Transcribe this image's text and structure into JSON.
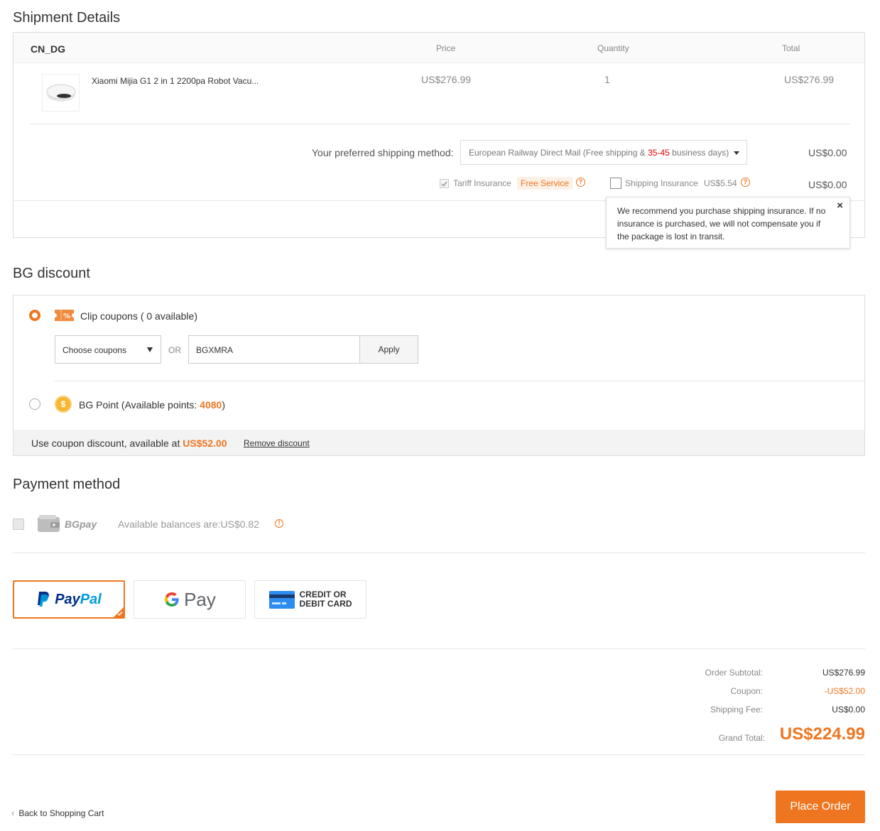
{
  "shipment": {
    "heading": "Shipment Details",
    "warehouse": "CN_DG",
    "columns": {
      "price": "Price",
      "quantity": "Quantity",
      "total": "Total"
    },
    "item": {
      "name": "Xiaomi Mijia G1 2 in 1 2200pa Robot Vacu...",
      "price": "US$276.99",
      "quantity": "1",
      "total": "US$276.99"
    },
    "shipping_method_label": "Your preferred shipping method:",
    "shipping_method_value_a": "European Railway Direct Mail (Free shipping & ",
    "shipping_method_value_days": "35-45",
    "shipping_method_value_b": " business days)",
    "shipping_cost": "US$0.00",
    "tariff_label": "Tariff Insurance",
    "tariff_badge": "Free Service",
    "shipping_insurance_label": "Shipping Insurance",
    "shipping_insurance_price": "US$5.54",
    "insurance_cost": "US$0.00",
    "tooltip_text": "We recommend you purchase shipping insurance. If no insurance is purchased, we will not compensate you if the package is lost in transit.",
    "tooltip_close": "×"
  },
  "discount": {
    "heading": "BG discount",
    "clip_label": "Clip coupons ( 0 available)",
    "choose_coupons": "Choose coupons",
    "or_label": "OR",
    "coupon_code": "BGXMRA",
    "apply_label": "Apply",
    "point_label_a": "BG Point (Available points: ",
    "point_value": "4080",
    "point_label_b": ")",
    "summary_a": "Use coupon discount, available at ",
    "summary_amount": "US$52.00",
    "remove_label": "Remove discount"
  },
  "payment": {
    "heading": "Payment method",
    "bgpay_label": "BGpay",
    "balance_text": "Available balances are:US$0.82",
    "paypal_a": "Pay",
    "paypal_b": "Pal",
    "gpay_label": "Pay",
    "card_line1": "CREDIT OR",
    "card_line2": "DEBIT CARD"
  },
  "totals": {
    "subtotal_label": "Order Subtotal:",
    "subtotal_value": "US$276.99",
    "coupon_label": "Coupon:",
    "coupon_value": "-US$52.00",
    "shipping_label": "Shipping Fee:",
    "shipping_value": "US$0.00",
    "grand_label": "Grand Total:",
    "grand_value": "US$224.99"
  },
  "footer": {
    "back_label": "Back to Shopping Cart",
    "place_order_label": "Place Order"
  },
  "colors": {
    "accent": "#ee7620",
    "red": "#e00000",
    "paypal_dark": "#003087",
    "paypal_light": "#009cde"
  }
}
